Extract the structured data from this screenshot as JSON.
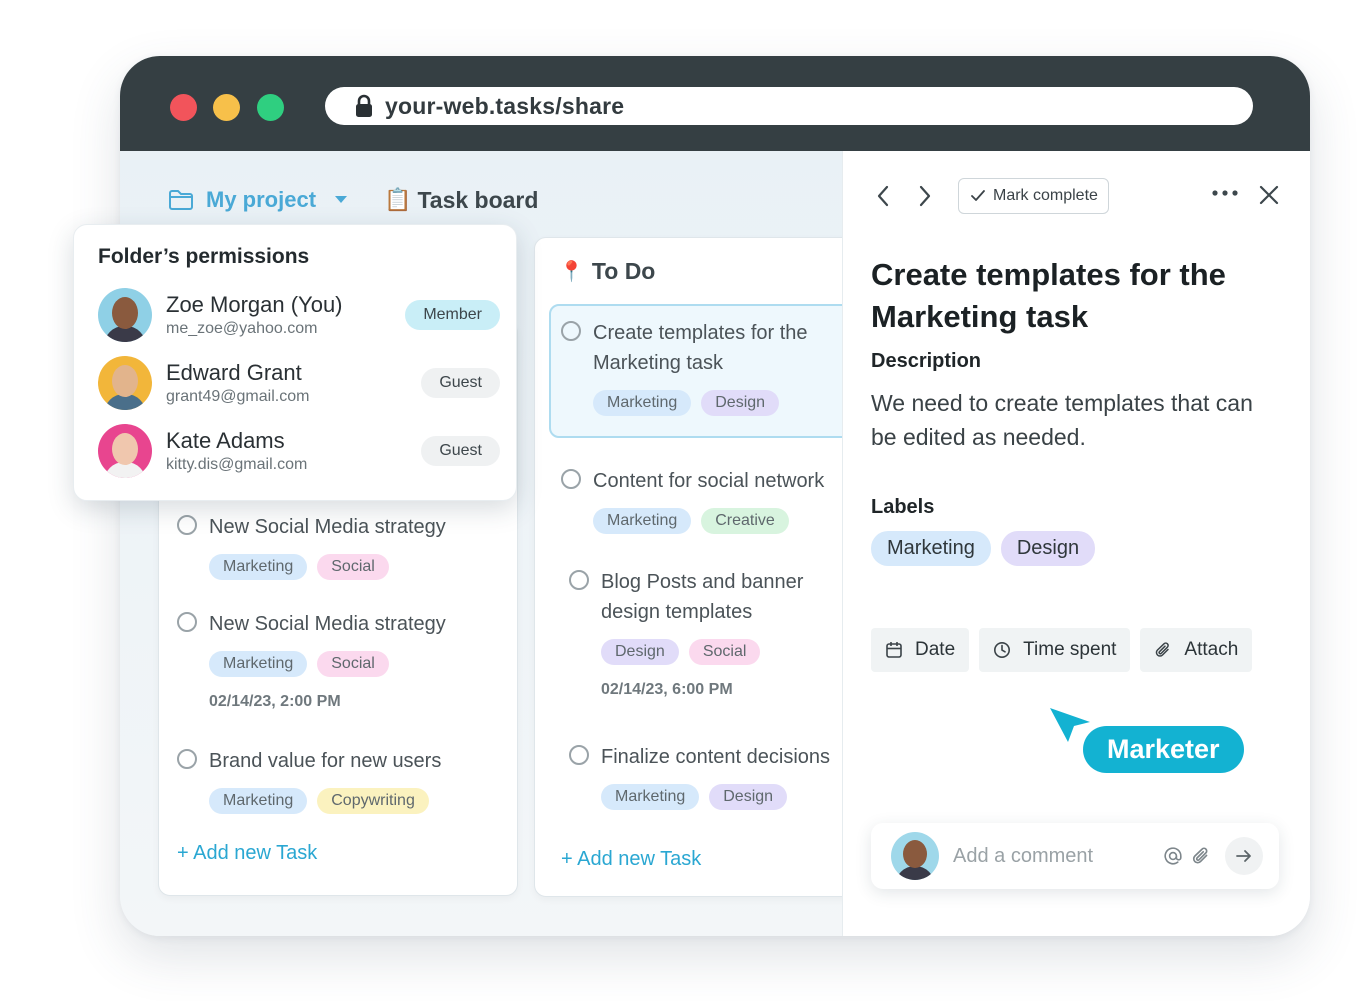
{
  "browser": {
    "url": "your-web.tasks/share",
    "icons": {
      "lock": "lock-icon"
    }
  },
  "breadcrumb": {
    "project": "My project",
    "board_emoji": "📋",
    "board": "Task board"
  },
  "permissions": {
    "title": "Folder’s permissions",
    "users": [
      {
        "name": "Zoe Morgan (You)",
        "email": "me_zoe@yahoo.com",
        "role": "Member"
      },
      {
        "name": "Edward Grant",
        "email": "grant49@gmail.com",
        "role": "Guest"
      },
      {
        "name": "Kate Adams",
        "email": "kitty.dis@gmail.com",
        "role": "Guest"
      }
    ]
  },
  "left_column": {
    "tasks": [
      {
        "title": "New Social Media strategy",
        "tags": [
          "Marketing",
          "Social"
        ]
      },
      {
        "title": "New Social Media strategy",
        "tags": [
          "Marketing",
          "Social"
        ],
        "date": "02/14/23, 2:00 PM"
      },
      {
        "title": "Brand value for new users",
        "tags": [
          "Marketing",
          "Copywriting"
        ]
      }
    ],
    "add_task": "+ Add new Task"
  },
  "todo_column": {
    "title": "To Do",
    "tasks": [
      {
        "title": "Create templates for the Marketing task",
        "tags": [
          "Marketing",
          "Design"
        ]
      },
      {
        "title": "Content for social network",
        "tags": [
          "Marketing",
          "Creative"
        ]
      },
      {
        "title": "Blog Posts and banner design templates",
        "tags": [
          "Design",
          "Social"
        ],
        "date": "02/14/23, 6:00 PM"
      },
      {
        "title": "Finalize content decisions",
        "tags": [
          "Marketing",
          "Design"
        ]
      }
    ],
    "add_task": "+ Add new Task"
  },
  "detail": {
    "mark_complete": "Mark complete",
    "title": "Create templates for the Marketing task",
    "description_label": "Description",
    "description": "We need to create templates that can be edited as needed.",
    "labels_label": "Labels",
    "labels": [
      "Marketing",
      "Design"
    ],
    "actions": {
      "date": "Date",
      "time_spent": "Time spent",
      "attach": "Attach"
    },
    "cursor_label": "Marketer",
    "comment_placeholder": "Add a comment"
  },
  "colors": {
    "accent": "#13b2d2",
    "titlebar": "#353f43",
    "tag_marketing": "#d6e9fb",
    "tag_design": "#e1dcf9",
    "tag_social": "#fbd9ee",
    "tag_creative": "#d8f4df",
    "tag_copywriting": "#fbf2bf"
  }
}
